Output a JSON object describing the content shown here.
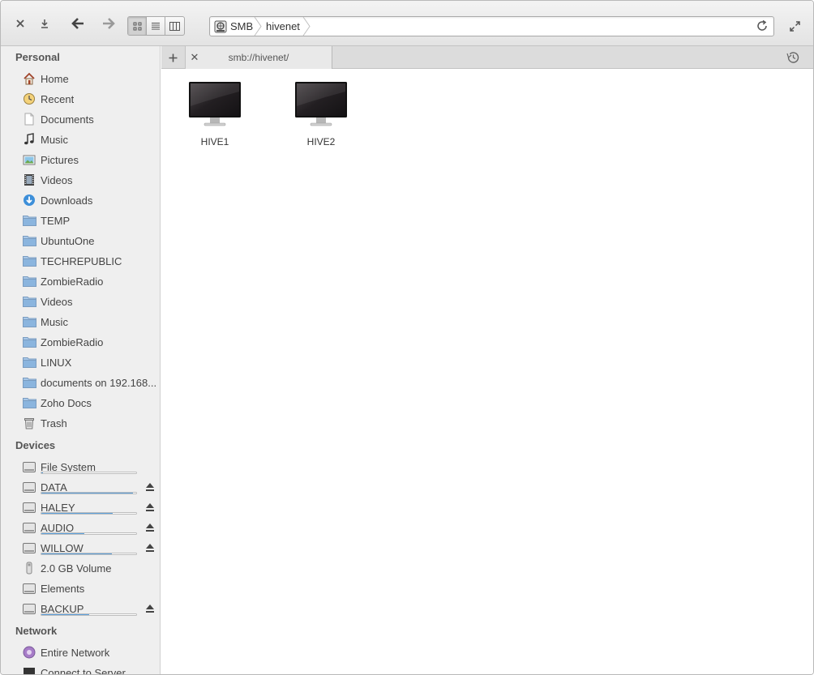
{
  "toolbar": {
    "close_icon": "close-icon",
    "download_icon": "download-icon",
    "back_icon": "arrow-left-icon",
    "forward_icon": "arrow-right-icon"
  },
  "view_modes": [
    "icon-view",
    "list-view",
    "column-view"
  ],
  "location": {
    "crumbs": [
      "SMB",
      "hivenet"
    ]
  },
  "tabs": [
    {
      "label": "smb://hivenet/"
    }
  ],
  "sidebar": {
    "personal": {
      "title": "Personal",
      "items": [
        {
          "label": "Home",
          "icon": "home-icon"
        },
        {
          "label": "Recent",
          "icon": "recent-icon"
        },
        {
          "label": "Documents",
          "icon": "document-icon"
        },
        {
          "label": "Music",
          "icon": "music-icon"
        },
        {
          "label": "Pictures",
          "icon": "pictures-icon"
        },
        {
          "label": "Videos",
          "icon": "videos-icon"
        },
        {
          "label": "Downloads",
          "icon": "downloads-icon"
        },
        {
          "label": "TEMP",
          "icon": "folder-icon"
        },
        {
          "label": "UbuntuOne",
          "icon": "folder-icon"
        },
        {
          "label": "TECHREPUBLIC",
          "icon": "folder-icon"
        },
        {
          "label": "ZombieRadio",
          "icon": "folder-icon"
        },
        {
          "label": "Videos",
          "icon": "folder-icon"
        },
        {
          "label": "Music",
          "icon": "folder-icon"
        },
        {
          "label": "ZombieRadio",
          "icon": "folder-icon"
        },
        {
          "label": "LINUX",
          "icon": "folder-icon"
        },
        {
          "label": "documents on 192.168....",
          "icon": "folder-icon"
        },
        {
          "label": "Zoho Docs",
          "icon": "folder-icon"
        },
        {
          "label": "Trash",
          "icon": "trash-icon"
        }
      ]
    },
    "devices": {
      "title": "Devices",
      "items": [
        {
          "label": "File System",
          "icon": "drive-icon",
          "usage": 0.02,
          "eject": false
        },
        {
          "label": "DATA",
          "icon": "drive-icon",
          "usage": 0.97,
          "eject": true
        },
        {
          "label": "HALEY",
          "icon": "drive-icon",
          "usage": 0.75,
          "eject": true
        },
        {
          "label": "AUDIO",
          "icon": "drive-icon",
          "usage": 0.45,
          "eject": true
        },
        {
          "label": "WILLOW",
          "icon": "drive-icon",
          "usage": 0.74,
          "eject": true
        },
        {
          "label": "2.0 GB Volume",
          "icon": "usb-icon",
          "usage": null,
          "eject": false
        },
        {
          "label": "Elements",
          "icon": "drive-icon",
          "usage": null,
          "eject": false
        },
        {
          "label": "BACKUP",
          "icon": "drive-icon",
          "usage": 0.5,
          "eject": true
        }
      ]
    },
    "network": {
      "title": "Network",
      "items": [
        {
          "label": "Entire Network",
          "icon": "network-icon"
        },
        {
          "label": "Connect to Server",
          "icon": "server-icon"
        }
      ]
    }
  },
  "content": {
    "items": [
      {
        "label": "HIVE1",
        "icon": "computer-icon"
      },
      {
        "label": "HIVE2",
        "icon": "computer-icon"
      }
    ]
  },
  "colors": {
    "accent": "#5fa2dd",
    "sidebar_bg": "#efefef",
    "folder": "#8bb5de"
  }
}
